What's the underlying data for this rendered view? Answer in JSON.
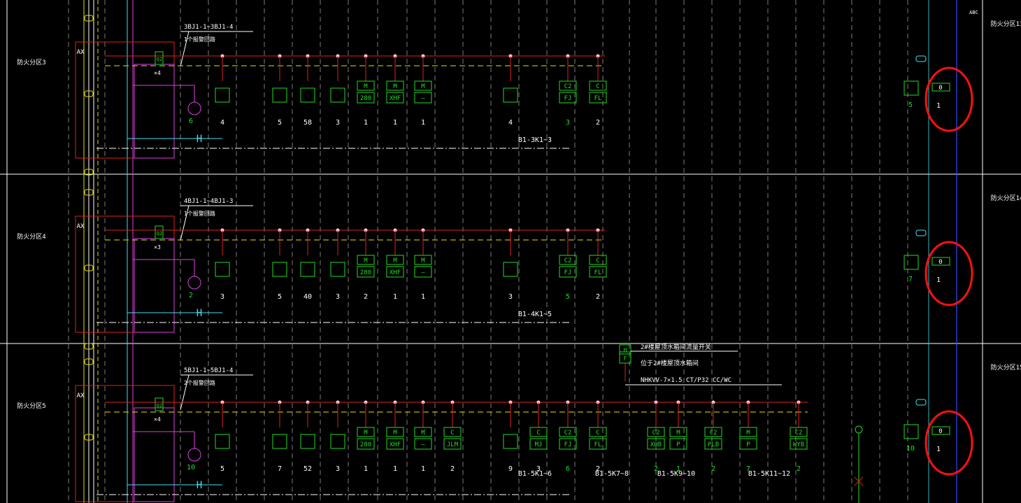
{
  "colors": {
    "background": "#000000",
    "bus_red": "#e02020",
    "bus_yellow": "#e8e000",
    "device_green": "#22dd22",
    "cyan": "#40e0f0",
    "magenta": "#e040e0",
    "white": "#ffffff",
    "blue_line": "#3050ff",
    "highlight_red": "#ff1010"
  },
  "top_right_note": "ABC",
  "zones": [
    {
      "left_label": "防火分区3",
      "right_label": "防火分区13",
      "ax_label": "AX",
      "range_label": "3BJ1-1~3BJ1-4",
      "loop_label": "1个报警回路",
      "module_label": "Q2",
      "multiplier": "×4",
      "bell_count": "6",
      "devices": [
        {
          "top": "",
          "bottom": "",
          "count": "4"
        },
        {
          "top": "",
          "bottom": "",
          "count": "5"
        },
        {
          "top": "",
          "bottom": "",
          "count": "58"
        },
        {
          "top": "",
          "bottom": "",
          "count": "3"
        },
        {
          "top": "M",
          "bottom": "280",
          "count": "1"
        },
        {
          "top": "M",
          "bottom": "XHF",
          "count": "1"
        },
        {
          "top": "M",
          "bottom": "—",
          "count": "1"
        },
        {
          "top": "",
          "bottom": "",
          "count": "4"
        },
        {
          "top": "C2",
          "bottom": "FJ",
          "count": "3"
        },
        {
          "top": "C",
          "bottom": "FL",
          "count": "2"
        }
      ],
      "branch_label": "B1-3K1~3",
      "right_panel": {
        "box": "0",
        "number": "1",
        "phone_count": "5"
      }
    },
    {
      "left_label": "防火分区4",
      "right_label": "防火分区14",
      "ax_label": "AX",
      "range_label": "4BJ1-1~4BJ1-3",
      "loop_label": "1个报警回路",
      "module_label": "Q2",
      "multiplier": "×3",
      "bell_count": "2",
      "devices": [
        {
          "top": "",
          "bottom": "",
          "count": "3"
        },
        {
          "top": "",
          "bottom": "",
          "count": "5"
        },
        {
          "top": "",
          "bottom": "",
          "count": "40"
        },
        {
          "top": "",
          "bottom": "",
          "count": "3"
        },
        {
          "top": "M",
          "bottom": "280",
          "count": "2"
        },
        {
          "top": "M",
          "bottom": "XHF",
          "count": "1"
        },
        {
          "top": "M",
          "bottom": "—",
          "count": "1"
        },
        {
          "top": "",
          "bottom": "",
          "count": "3"
        },
        {
          "top": "C2",
          "bottom": "FJ",
          "count": "5"
        },
        {
          "top": "C",
          "bottom": "FL",
          "count": "2"
        }
      ],
      "branch_label": "B1-4K1~5",
      "right_panel": {
        "box": "0",
        "number": "1",
        "phone_count": "7"
      }
    },
    {
      "left_label": "防火分区5",
      "right_label": "防火分区15",
      "ax_label": "AX",
      "range_label": "5BJ1-1~5BJ1-4",
      "loop_label": "2个报警回路",
      "module_label": "Q2",
      "multiplier": "×4",
      "bell_count": "10",
      "devices": [
        {
          "top": "",
          "bottom": "",
          "count": "5"
        },
        {
          "top": "",
          "bottom": "",
          "count": "7"
        },
        {
          "top": "",
          "bottom": "",
          "count": "52"
        },
        {
          "top": "",
          "bottom": "",
          "count": "3"
        },
        {
          "top": "M",
          "bottom": "280",
          "count": "1"
        },
        {
          "top": "M",
          "bottom": "XHF",
          "count": "1"
        },
        {
          "top": "M",
          "bottom": "—",
          "count": "1"
        },
        {
          "top": "C",
          "bottom": "JLM",
          "count": "2"
        },
        {
          "top": "",
          "bottom": "",
          "count": "9"
        },
        {
          "top": "C",
          "bottom": "MJ",
          "count": "3"
        },
        {
          "top": "C2",
          "bottom": "FJ",
          "count": "6"
        },
        {
          "top": "C",
          "bottom": "FL",
          "count": "2"
        },
        {
          "top": "C2",
          "bottom": "XHB",
          "count": "2"
        },
        {
          "top": "M",
          "bottom": "P",
          "count": "1"
        },
        {
          "top": "C2",
          "bottom": "PLB",
          "count": "2"
        },
        {
          "top": "M",
          "bottom": "P",
          "count": "7"
        },
        {
          "top": "C2",
          "bottom": "WYB",
          "count": "2"
        }
      ],
      "branch_labels": [
        "B1-5K1~6",
        "B1-5K7~8",
        "B1-5K9~10",
        "B1-5K11~12"
      ],
      "right_panel": {
        "box": "0",
        "number": "1",
        "phone_count": "10"
      }
    }
  ],
  "annotation": {
    "box_top": "H",
    "box_bottom": "F",
    "line1": "2#楼屋顶水箱间流量开关",
    "line2": "位于2#楼屋顶水箱间",
    "cable": "NHKVV-7×1.5 CT/P32 CC/WC"
  }
}
